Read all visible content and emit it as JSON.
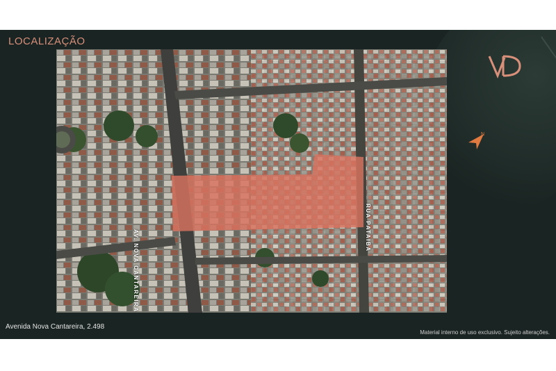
{
  "slide": {
    "title": "LOCALIZAÇÃO",
    "logo_text": "VD",
    "address": "Avenida Nova Cantareira, 2.498",
    "disclaimer": "Material interno de uso exclusivo. Sujeito alterações."
  },
  "map": {
    "streets": [
      {
        "id": "av-nova-cantareira",
        "label": "AV. NOVA CANTAREIRA"
      },
      {
        "id": "rua-pataiba",
        "label": "RUA PATAIBA"
      }
    ],
    "plot_color": "#d9735f",
    "north_icon": "compass-north-icon"
  },
  "colors": {
    "background": "#1a2422",
    "accent": "#d8907a"
  }
}
